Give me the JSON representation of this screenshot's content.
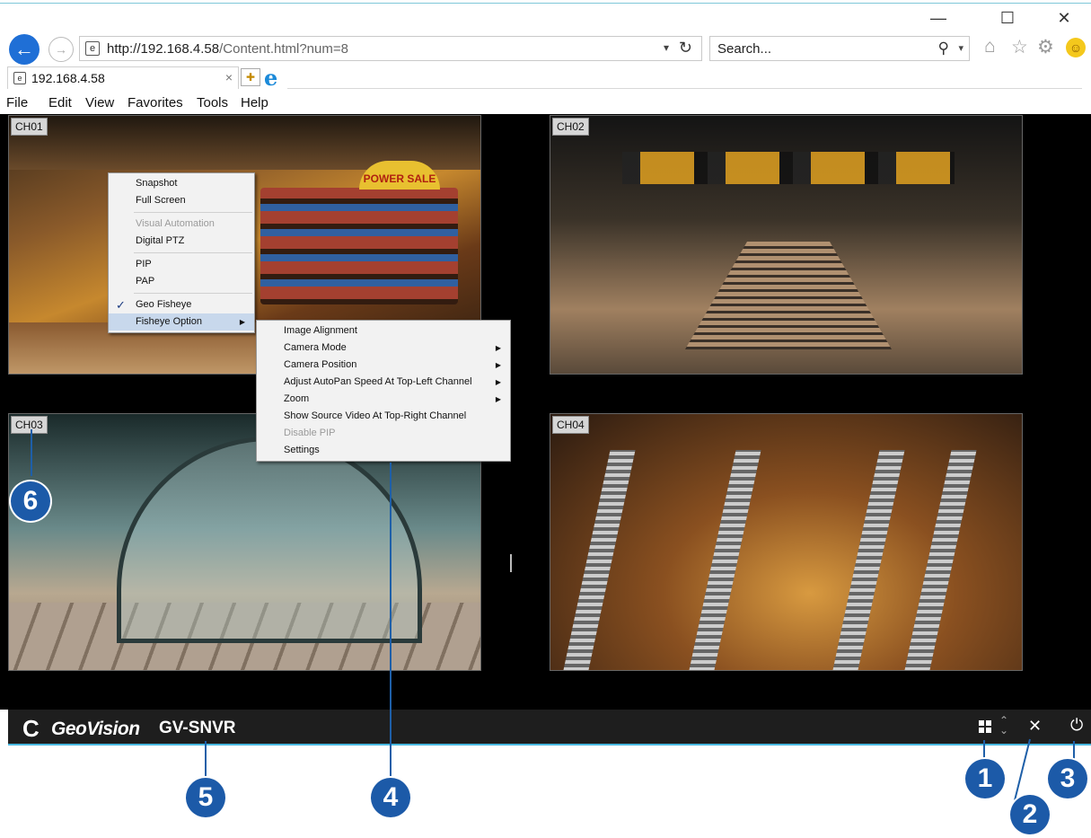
{
  "window": {
    "minimize": "—",
    "maximize": "☐",
    "close": "✕"
  },
  "browser": {
    "url_host": "http://192.168.4.58",
    "url_path": "/Content.html?num=8",
    "search_placeholder": "Search...",
    "tab_title": "192.168.4.58",
    "tab_close": "×"
  },
  "menubar": [
    "File",
    "Edit",
    "View",
    "Favorites",
    "Tools",
    "Help"
  ],
  "channels": [
    "CH01",
    "CH02",
    "CH03",
    "CH04"
  ],
  "ch1_sign": "POWER SALE",
  "context_menu": {
    "items": [
      "Snapshot",
      "Full Screen",
      "Visual Automation",
      "Digital PTZ",
      "PIP",
      "PAP",
      "Geo Fisheye",
      "Fisheye Option"
    ],
    "disabled": [
      "Visual Automation"
    ],
    "checked": [
      "Geo Fisheye"
    ],
    "highlighted": "Fisheye Option"
  },
  "fisheye_submenu": {
    "items": [
      "Image Alignment",
      "Camera Mode",
      "Camera Position",
      "Adjust AutoPan Speed At Top-Left Channel",
      "Zoom",
      "Show Source Video At Top-Right Channel",
      "Disable PIP",
      "Settings"
    ],
    "with_arrow": [
      "Camera Mode",
      "Camera Position",
      "Adjust AutoPan Speed At Top-Left Channel",
      "Zoom"
    ],
    "disabled": [
      "Disable PIP"
    ]
  },
  "footer": {
    "brand": "GeoVision",
    "product": "GV-SNVR"
  },
  "callouts": [
    "1",
    "2",
    "3",
    "4",
    "5",
    "6"
  ],
  "colors": {
    "accent": "#1c5aa8",
    "bar": "#1e1e1e",
    "underline": "#48b8e0"
  }
}
